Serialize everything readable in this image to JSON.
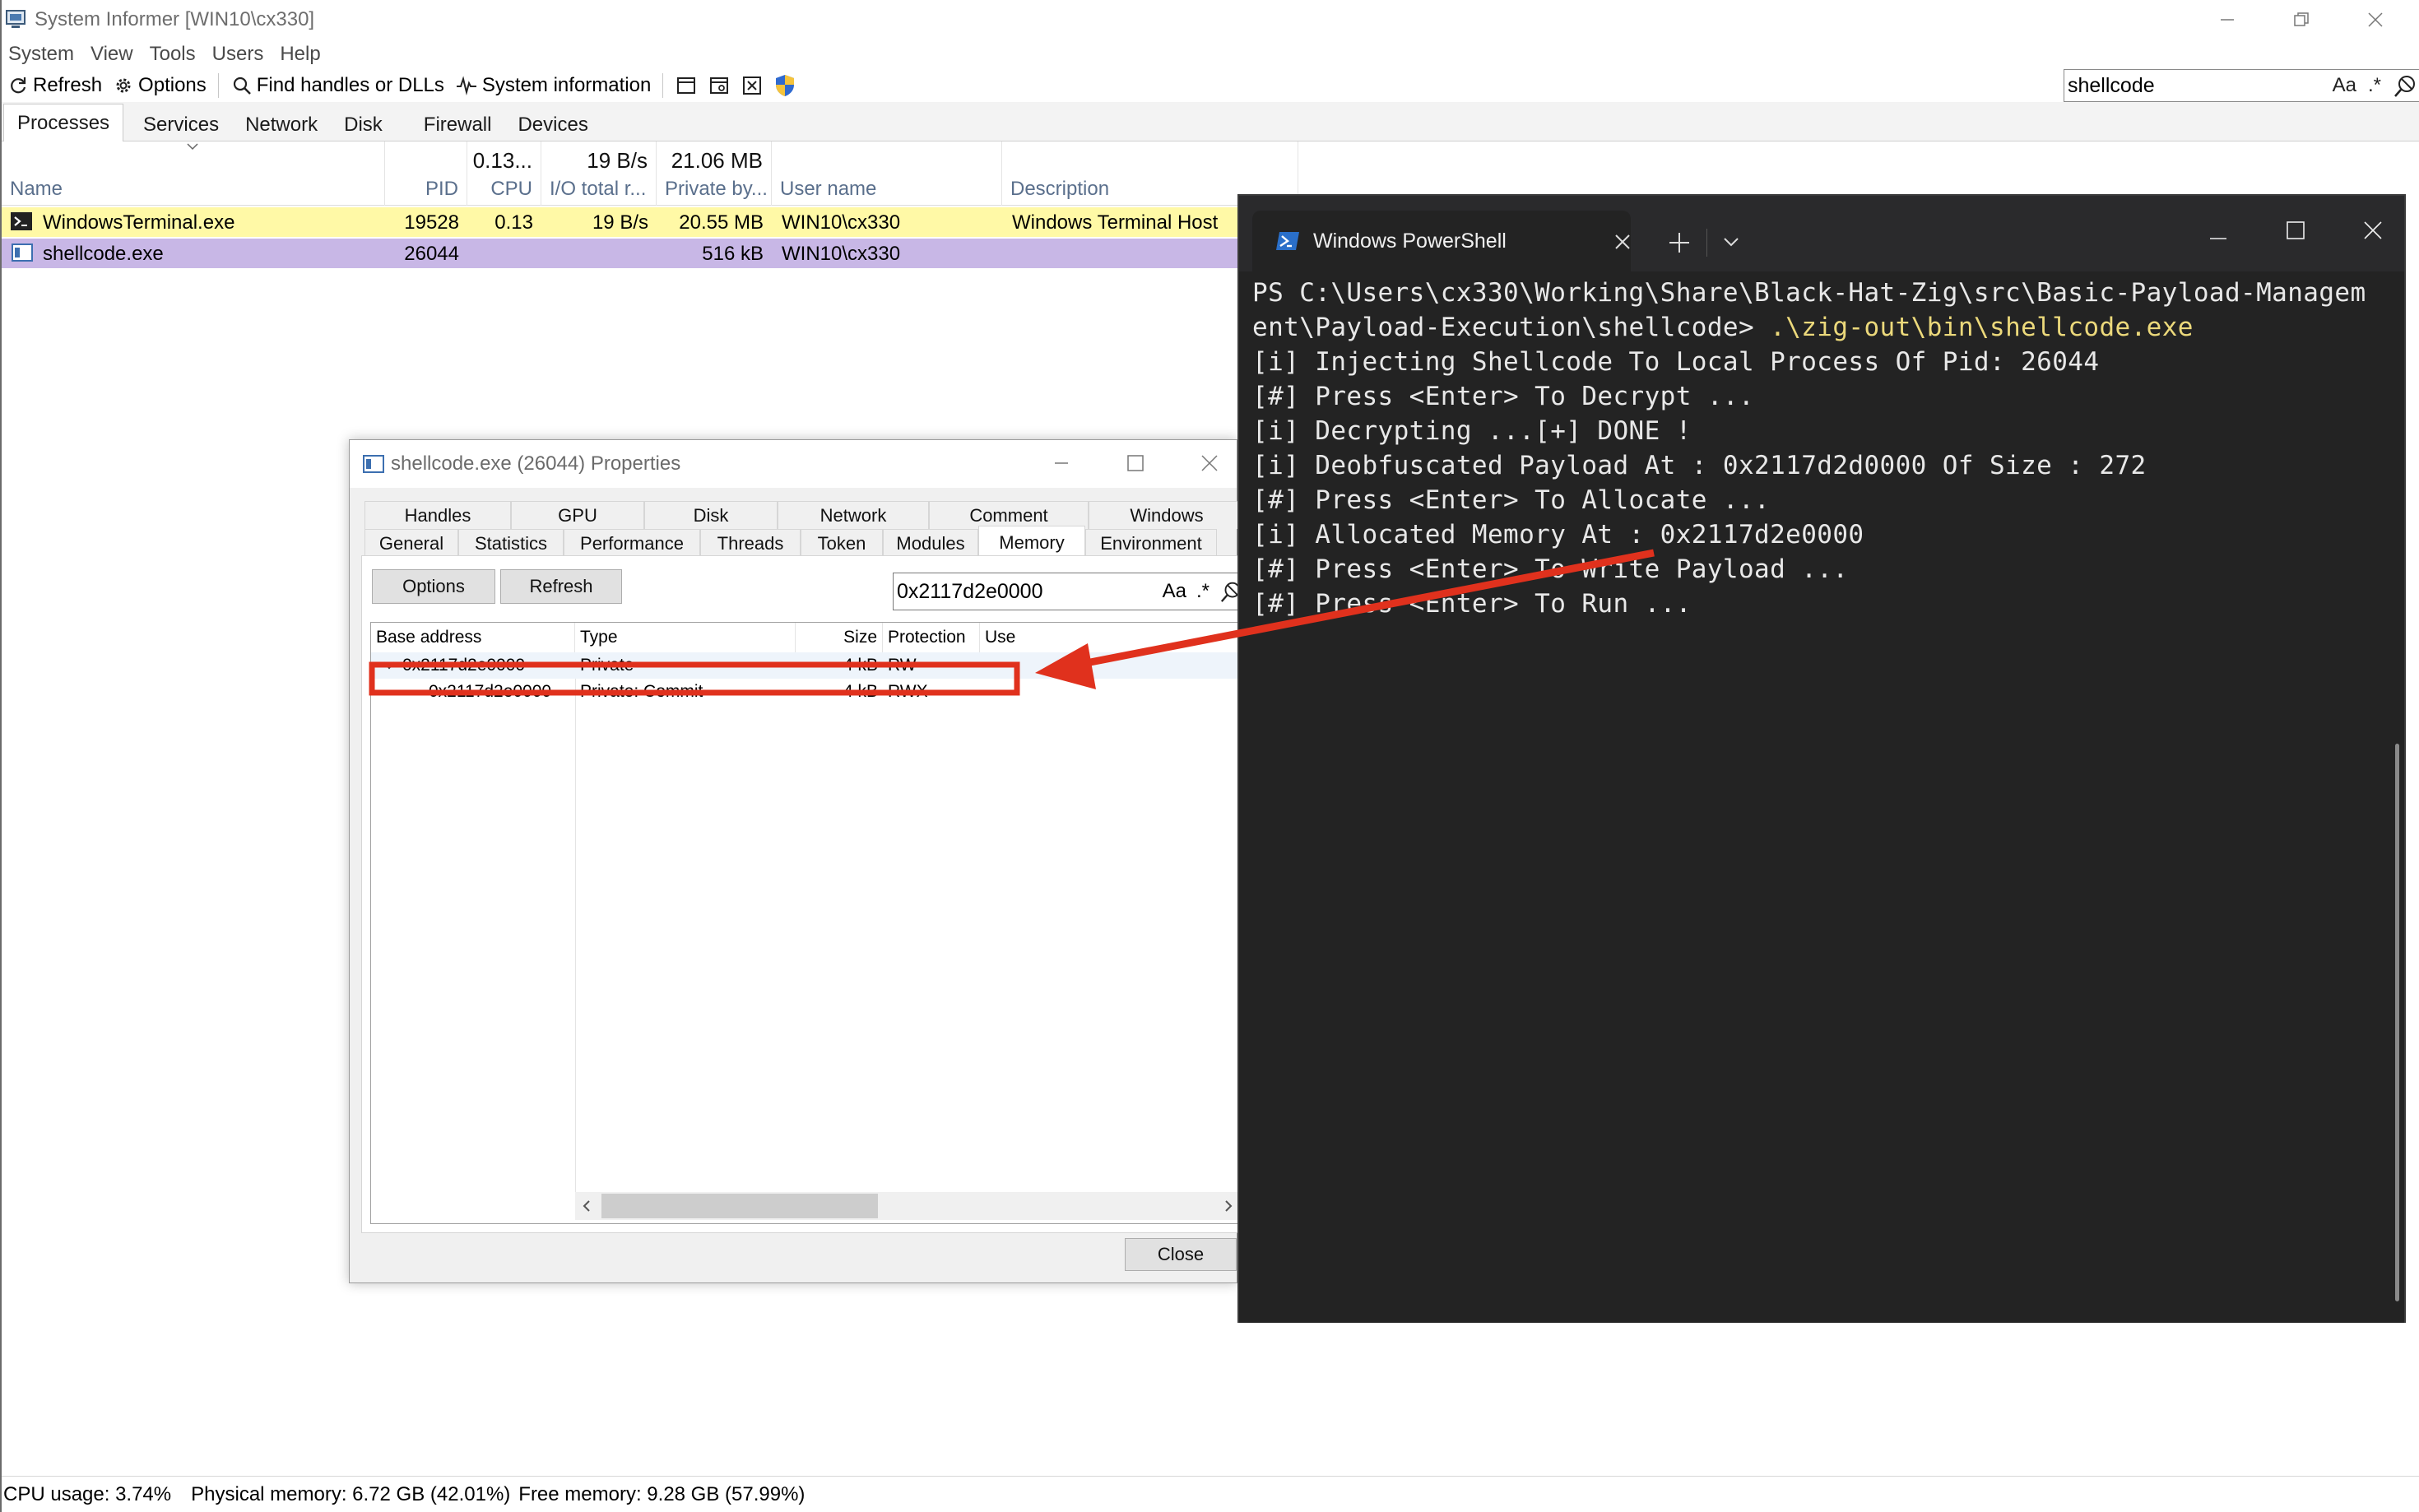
{
  "main_window": {
    "title": "System Informer [WIN10\\cx330]",
    "menu": [
      "System",
      "View",
      "Tools",
      "Users",
      "Help"
    ],
    "toolbar": {
      "refresh": "Refresh",
      "options": "Options",
      "find_handles": "Find handles or DLLs",
      "system_information": "System information"
    },
    "search": {
      "value": "shellcode",
      "case_option": "Aa",
      "regex_option": ".*"
    },
    "tabs": [
      "Processes",
      "Services",
      "Network",
      "Disk",
      "Firewall",
      "Devices"
    ],
    "active_tab": "Processes",
    "columns": {
      "name": "Name",
      "pid": "PID",
      "cpu": "CPU",
      "cpu_total": "0.13...",
      "io": "I/O total r...",
      "io_total": "19 B/s",
      "private": "Private by...",
      "private_total": "21.06 MB",
      "user": "User name",
      "description": "Description"
    },
    "processes": [
      {
        "name": "WindowsTerminal.exe",
        "pid": "19528",
        "cpu": "0.13",
        "io": "19 B/s",
        "private": "20.55 MB",
        "user": "WIN10\\cx330",
        "description": "Windows Terminal Host",
        "row_color": "#fff9a6"
      },
      {
        "name": "shellcode.exe",
        "pid": "26044",
        "cpu": "",
        "io": "",
        "private": "516 kB",
        "user": "WIN10\\cx330",
        "description": "",
        "row_color": "#c8b7e6"
      }
    ],
    "status": {
      "cpu": "CPU usage: 3.74%",
      "physical": "Physical memory: 6.72 GB (42.01%)",
      "free": "Free memory: 9.28 GB (57.99%)"
    }
  },
  "properties": {
    "title": "shellcode.exe (26044) Properties",
    "tabs_row1": [
      "Handles",
      "GPU",
      "Disk",
      "Network",
      "Comment",
      "Windows"
    ],
    "tabs_row2": [
      "General",
      "Statistics",
      "Performance",
      "Threads",
      "Token",
      "Modules",
      "Memory",
      "Environment"
    ],
    "active_tab": "Memory",
    "options_button": "Options",
    "refresh_button": "Refresh",
    "filter": {
      "value": "0x2117d2e0000",
      "case_option": "Aa",
      "regex_option": ".*"
    },
    "columns": {
      "base": "Base address",
      "type": "Type",
      "size": "Size",
      "protection": "Protection",
      "use": "Use"
    },
    "rows": [
      {
        "base": "0x2117d2e0000",
        "type": "Private",
        "size": "4 kB",
        "protection": "RW",
        "expanded": true
      },
      {
        "base": "0x2117d2e0000",
        "type": "Private: Commit",
        "size": "4 kB",
        "protection": "RWX",
        "highlighted": true
      }
    ],
    "close_button": "Close"
  },
  "terminal": {
    "tab_title": "Windows PowerShell",
    "lines": [
      "PS C:\\Users\\cx330\\Working\\Share\\Black-Hat-Zig\\src\\Basic-Payload-Managem",
      "ent\\Payload-Execution\\shellcode> ",
      "[i] Injecting Shellcode To Local Process Of Pid: 26044",
      "[#] Press <Enter> To Decrypt ...",
      "[i] Decrypting ...[+] DONE !",
      "[i] Deobfuscated Payload At : 0x2117d2d0000 Of Size : 272",
      "[#] Press <Enter> To Allocate ...",
      "[i] Allocated Memory At : 0x2117d2e0000",
      "[#] Press <Enter> To Write Payload ...",
      "[#] Press <Enter> To Run ..."
    ],
    "command": ".\\zig-out\\bin\\shellcode.exe"
  },
  "colors": {
    "highlight_red": "#e0311d",
    "terminal_bg": "#232323",
    "command_yellow": "#ecd97b"
  }
}
